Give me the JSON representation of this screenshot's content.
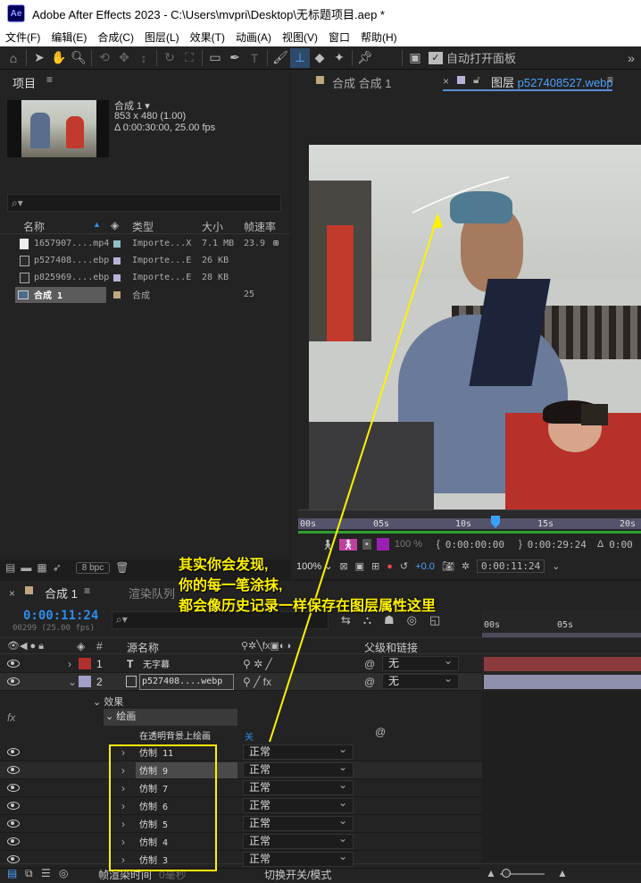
{
  "app": {
    "title": "Adobe After Effects 2023 - C:\\Users\\mvpri\\Desktop\\无标题项目.aep *",
    "logo": "Ae"
  },
  "menu": [
    "文件(F)",
    "编辑(E)",
    "合成(C)",
    "图层(L)",
    "效果(T)",
    "动画(A)",
    "视图(V)",
    "窗口",
    "帮助(H)"
  ],
  "toolbar": {
    "auto_open": "自动打开面板"
  },
  "project": {
    "tab": "项目",
    "comp_name": "合成 1",
    "comp_size": "853 x 480 (1.00)",
    "comp_duration": "Δ 0:00:30:00, 25.00 fps",
    "columns": {
      "name": "名称",
      "type": "类型",
      "size": "大小",
      "fps": "帧速率"
    },
    "items": [
      {
        "name": "1657907....mp4",
        "type": "Importe...X",
        "size": "7.1 MB",
        "fps": "23.9"
      },
      {
        "name": "p527408....ebp",
        "type": "Importe...E",
        "size": "26 KB",
        "fps": ""
      },
      {
        "name": "p825969....ebp",
        "type": "Importe...E",
        "size": "28 KB",
        "fps": ""
      },
      {
        "name": "合成 1",
        "type": "合成",
        "size": "",
        "fps": "25"
      }
    ],
    "bpc": "8 bpc"
  },
  "viewer": {
    "tab_comp": "合成 合成 1",
    "tab_layer_prefix": "图层",
    "tab_layer_name": "p527408527.webp",
    "ruler": [
      "00s",
      "05s",
      "10s",
      "15s",
      "20s"
    ],
    "time_start": "0:00:00:00",
    "time_end": "0:00:29:24",
    "time_delta": "0:00",
    "opacity": "100 %",
    "zoom": "100%",
    "exposure": "+0.0",
    "current_time": "0:00:11:24"
  },
  "timeline": {
    "tab": "合成 1",
    "render_tab": "渲染队列",
    "timecode": "0:00:11:24",
    "frames": "00299 (25.00 fps)",
    "col_source": "源名称",
    "col_parent": "父级和链接",
    "ruler": [
      "00s",
      "05s"
    ],
    "layers": [
      {
        "num": "1",
        "name": "无字幕",
        "parent": "无",
        "color": "#b03030"
      },
      {
        "num": "2",
        "name": "p527408....webp",
        "parent": "无",
        "color": "#a0a0c8"
      }
    ],
    "effects_label": "效果",
    "effect_name": "绘画",
    "on_transparent": "在透明背景上绘画",
    "on_transparent_value": "关",
    "strokes": [
      {
        "name": "仿制 11",
        "mode": "正常"
      },
      {
        "name": "仿制 9",
        "mode": "正常"
      },
      {
        "name": "仿制 7",
        "mode": "正常"
      },
      {
        "name": "仿制 6",
        "mode": "正常"
      },
      {
        "name": "仿制 5",
        "mode": "正常"
      },
      {
        "name": "仿制 4",
        "mode": "正常"
      },
      {
        "name": "仿制 3",
        "mode": "正常"
      }
    ],
    "footer_render_time": "帧渲染时间",
    "footer_render_value": "0毫秒",
    "footer_toggle": "切换开关/模式"
  },
  "annotation": {
    "line1": "其实你会发现,",
    "line2": "你的每一笔涂抹,",
    "line3": "都会像历史记录一样保存在图层属性这里"
  },
  "colors": {
    "accent": "#2d8ceb",
    "annotation": "#fff200",
    "playhead": "#3aa0ff"
  }
}
